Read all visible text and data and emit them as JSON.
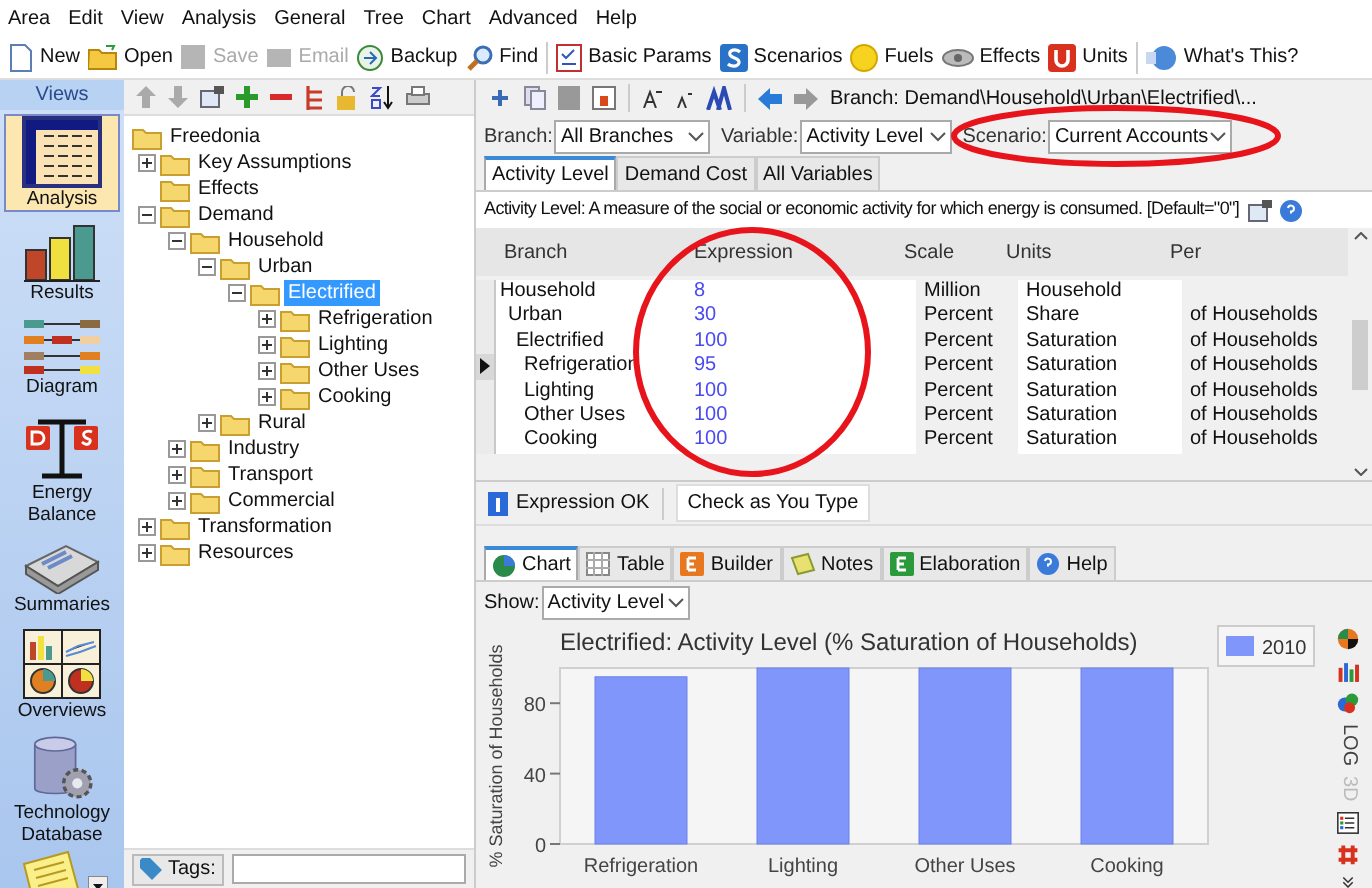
{
  "menu": [
    "Area",
    "Edit",
    "View",
    "Analysis",
    "General",
    "Tree",
    "Chart",
    "Advanced",
    "Help"
  ],
  "toolbar": [
    {
      "label": "New",
      "disabled": false
    },
    {
      "label": "Open",
      "disabled": false
    },
    {
      "label": "Save",
      "disabled": true
    },
    {
      "label": "Email",
      "disabled": true
    },
    {
      "label": "Backup",
      "disabled": false
    },
    {
      "label": "Find",
      "disabled": false
    },
    {
      "label": "Basic Params",
      "disabled": false
    },
    {
      "label": "Scenarios",
      "disabled": false
    },
    {
      "label": "Fuels",
      "disabled": false
    },
    {
      "label": "Effects",
      "disabled": false
    },
    {
      "label": "Units",
      "disabled": false
    },
    {
      "label": "What's This?",
      "disabled": false
    }
  ],
  "views": {
    "title": "Views",
    "items": [
      {
        "label": "Analysis",
        "selected": true
      },
      {
        "label": "Results",
        "selected": false
      },
      {
        "label": "Diagram",
        "selected": false
      },
      {
        "label": "Energy Balance",
        "selected": false
      },
      {
        "label": "Summaries",
        "selected": false
      },
      {
        "label": "Overviews",
        "selected": false
      },
      {
        "label": "Technology Database",
        "selected": false
      }
    ]
  },
  "tree": [
    {
      "label": "Freedonia",
      "selected": false,
      "children": [
        {
          "label": "Key Assumptions",
          "selected": false,
          "expanded": false
        },
        {
          "label": "Effects",
          "selected": false
        },
        {
          "label": "Demand",
          "selected": false,
          "expanded": true,
          "children": [
            {
              "label": "Household",
              "selected": false,
              "expanded": true,
              "children": [
                {
                  "label": "Urban",
                  "selected": false,
                  "expanded": true,
                  "children": [
                    {
                      "label": "Electrified",
                      "selected": true,
                      "expanded": true,
                      "children": [
                        {
                          "label": "Refrigeration",
                          "selected": false,
                          "expanded": false
                        },
                        {
                          "label": "Lighting",
                          "selected": false,
                          "expanded": false
                        },
                        {
                          "label": "Other Uses",
                          "selected": false,
                          "expanded": false
                        },
                        {
                          "label": "Cooking",
                          "selected": false,
                          "expanded": false
                        }
                      ]
                    }
                  ]
                },
                {
                  "label": "Rural",
                  "selected": false,
                  "expanded": false
                }
              ]
            },
            {
              "label": "Industry",
              "selected": false,
              "expanded": false
            },
            {
              "label": "Transport",
              "selected": false,
              "expanded": false
            },
            {
              "label": "Commercial",
              "selected": false,
              "expanded": false
            }
          ]
        },
        {
          "label": "Transformation",
          "selected": false,
          "expanded": false
        },
        {
          "label": "Resources",
          "selected": false,
          "expanded": false
        }
      ]
    }
  ],
  "tags": {
    "label": "Tags:"
  },
  "breadcrumb": "Branch: Demand\\Household\\Urban\\Electrified\\...",
  "filters": [
    {
      "label": "Branch:",
      "value": "All Branches"
    },
    {
      "label": "Variable:",
      "value": "Activity Level"
    },
    {
      "label": "Scenario:",
      "value": "Current Accounts"
    }
  ],
  "variable_tabs": [
    {
      "label": "Activity Level",
      "selected": true
    },
    {
      "label": "Demand Cost",
      "selected": false
    },
    {
      "label": "All Variables",
      "selected": false
    }
  ],
  "description": "Activity Level: A measure of the social or economic activity for which energy is consumed. [Default=\"0\"]",
  "table": {
    "columns": [
      "Branch",
      "Expression",
      "Scale",
      "Units",
      "Per"
    ],
    "rows": [
      {
        "branch": "Household",
        "expression": "8",
        "scale": "Million",
        "units": "Household",
        "selected": false,
        "children": [
          {
            "branch": "Urban",
            "expression": "30",
            "scale": "Percent",
            "units": "Share",
            "per": "of Households",
            "selected": false,
            "children": [
              {
                "branch": "Electrified",
                "expression": "100",
                "scale": "Percent",
                "units": "Saturation",
                "per": "of Households",
                "selected": false,
                "children": [
                  {
                    "branch": "Refrigeration",
                    "expression": "95",
                    "scale": "Percent",
                    "units": "Saturation",
                    "per": "of Households",
                    "selected": true
                  },
                  {
                    "branch": "Lighting",
                    "expression": "100",
                    "scale": "Percent",
                    "units": "Saturation",
                    "per": "of Households",
                    "selected": false
                  },
                  {
                    "branch": "Other Uses",
                    "expression": "100",
                    "scale": "Percent",
                    "units": "Saturation",
                    "per": "of Households",
                    "selected": false
                  },
                  {
                    "branch": "Cooking",
                    "expression": "100",
                    "scale": "Percent",
                    "units": "Saturation",
                    "per": "of Households",
                    "selected": false
                  }
                ]
              }
            ]
          }
        ]
      }
    ]
  },
  "status": {
    "message": "Expression OK",
    "check_button": "Check as You Type"
  },
  "result_tabs": [
    {
      "label": "Chart",
      "selected": true
    },
    {
      "label": "Table",
      "selected": false
    },
    {
      "label": "Builder",
      "selected": false
    },
    {
      "label": "Notes",
      "selected": false
    },
    {
      "label": "Elaboration",
      "selected": false
    },
    {
      "label": "Help",
      "selected": false
    }
  ],
  "show": {
    "label": "Show:",
    "value": "Activity Level"
  },
  "chart_data": {
    "type": "bar",
    "title": "Electrified: Activity Level (% Saturation of Households)",
    "ylabel": "% Saturation of Households",
    "categories": [
      "Refrigeration",
      "Lighting",
      "Other Uses",
      "Cooking"
    ],
    "series": [
      {
        "name": "2010",
        "color": "#8096fa",
        "values": [
          95,
          100,
          100,
          100
        ]
      }
    ],
    "ylim": [
      0,
      100
    ],
    "yticks": [
      0,
      40,
      80
    ]
  },
  "chart_tools": [
    {
      "kind": "pie"
    },
    {
      "kind": "bars"
    },
    {
      "kind": "bubbles"
    },
    {
      "kind": "text",
      "label": "LOG",
      "disabled": false
    },
    {
      "kind": "text",
      "label": "3D",
      "disabled": true
    },
    {
      "kind": "legend"
    },
    {
      "kind": "grid"
    },
    {
      "kind": "more"
    }
  ],
  "annotation_marks": [
    {
      "color": "#e8141b"
    },
    {
      "color": "#e8141b"
    }
  ]
}
